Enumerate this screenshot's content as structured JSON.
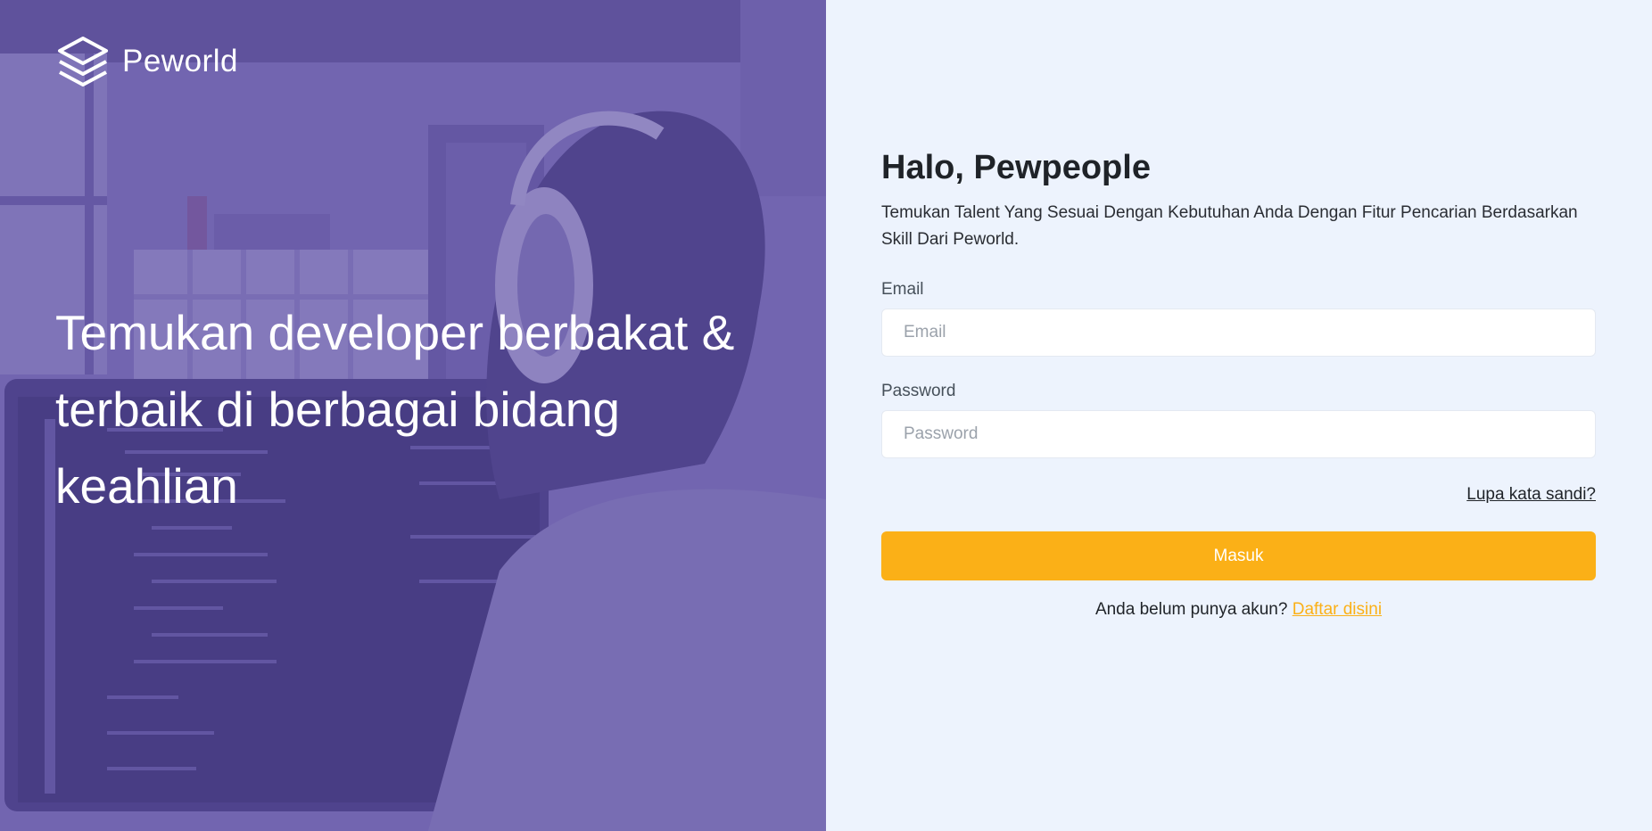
{
  "brand": {
    "name": "Peworld"
  },
  "hero": {
    "headline": "Temukan developer berbakat & terbaik di berbagai bidang keahlian"
  },
  "login": {
    "title": "Halo, Pewpeople",
    "subtitle": "Temukan Talent Yang Sesuai Dengan Kebutuhan Anda Dengan Fitur Pencarian Berdasarkan Skill Dari Peworld.",
    "email": {
      "label": "Email",
      "placeholder": "Email",
      "value": ""
    },
    "password": {
      "label": "Password",
      "placeholder": "Password",
      "value": ""
    },
    "forgot_label": "Lupa kata sandi?",
    "submit_label": "Masuk",
    "register_prompt": "Anda belum punya akun?",
    "register_link": "Daftar disini"
  },
  "colors": {
    "hero_overlay": "#5e50a1",
    "login_bg": "#edf3fd",
    "accent": "#fbb017"
  }
}
